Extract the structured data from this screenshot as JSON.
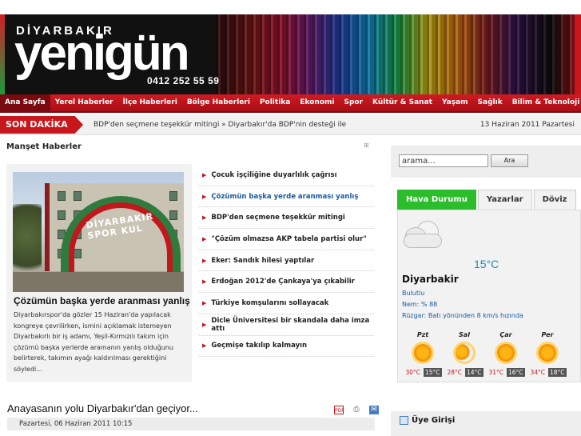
{
  "header": {
    "city": "DİYARBAKIR",
    "name": "yenigün",
    "phone": "0412 252 55 59"
  },
  "nav": [
    "Ana Sayfa",
    "Yerel Haberler",
    "İlçe Haberleri",
    "Bölge Haberleri",
    "Politika",
    "Ekonomi",
    "Spor",
    "Kültür & Sanat",
    "Yaşam",
    "Sağlık",
    "Bilim & Teknoloji"
  ],
  "breaking": {
    "label": "SON DAKİKA",
    "text": "BDP'den seçmene teşekkür mitingi » Diyarbakır'da BDP'nin desteği ile",
    "date": "13 Haziran 2011 Pazartesi"
  },
  "manset": {
    "title": "Manşet Haberler",
    "image_text": "DİYARBAKIR SPOR KUL",
    "headline": "Çözümün başka yerde aranması yanlış",
    "description": "Diyarbakırspor'da gözler 15 Haziran'da yapılacak kongreye çevrilirken, ismini açıklamak istemeyen Diyarbakırlı bir iş adamı, Yeşil-Kırmızılı takım için çözümü başka yerlerde aramanın yanlış olduğunu belirterek, takımın ayağı kaldırılması gerektiğini söyledi...",
    "items": [
      "Çocuk işçiliğine duyarlılık çağrısı",
      "Çözümün başka yerde aranması yanlış",
      "BDP'den seçmene teşekkür mitingi",
      "\"Çözüm olmazsa AKP tabela partisi olur\"",
      "Eker: Sandık hilesi yaptılar",
      "Erdoğan 2012'de Çankaya'ya çıkabilir",
      "Türkiye komşularını sollayacak",
      "Dicle Üniversitesi bir skandala daha imza attı",
      "Geçmişe takılıp kalmayın"
    ]
  },
  "article": {
    "title": "Anayasanın yolu Diyarbakır'dan geçiyor...",
    "date": "Pazartesi, 06 Haziran 2011 10:15"
  },
  "search": {
    "value": "arama...",
    "button": "Ara"
  },
  "tabs": [
    "Hava Durumu",
    "Yazarlar",
    "Döviz"
  ],
  "weather": {
    "temp": "15°C",
    "city": "Diyarbakir",
    "condition": "Bulutlu",
    "humidity": "Nem: % 88",
    "wind": "Rüzgar: Batı yönünden 8 km/s hızında",
    "days": [
      {
        "name": "Pzt",
        "hi": "30°C",
        "lo": "15°C"
      },
      {
        "name": "Sal",
        "hi": "28°C",
        "lo": "14°C"
      },
      {
        "name": "Çar",
        "hi": "31°C",
        "lo": "16°C"
      },
      {
        "name": "Per",
        "hi": "34°C",
        "lo": "18°C"
      }
    ]
  },
  "member": {
    "title": "Üye Girişi"
  }
}
